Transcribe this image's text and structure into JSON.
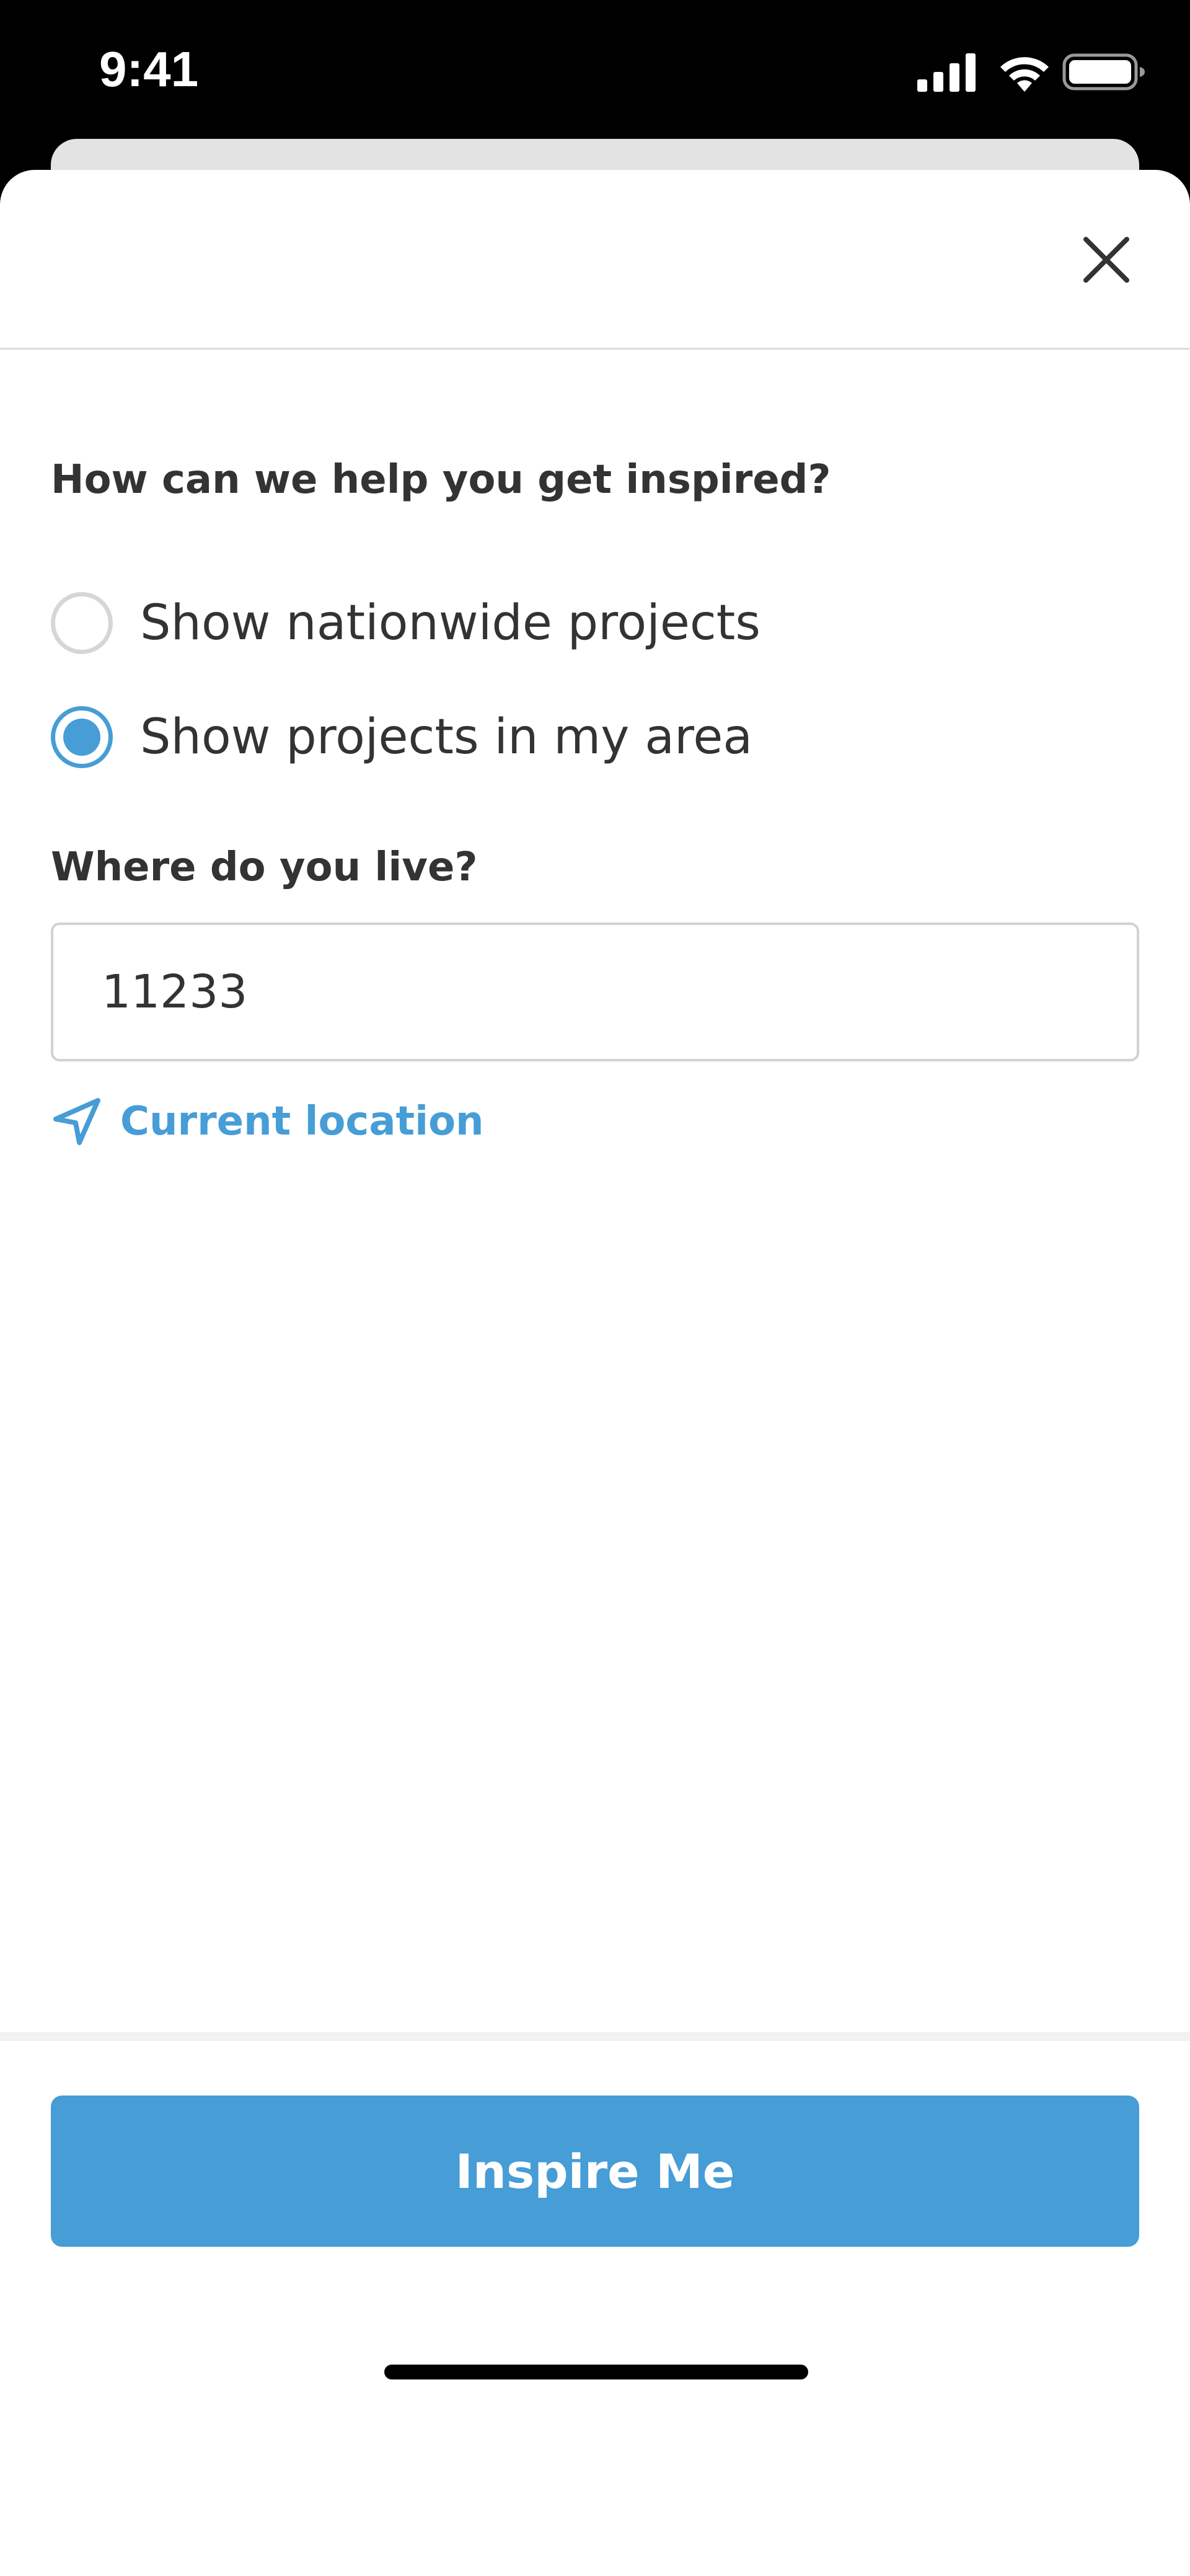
{
  "status_bar": {
    "time": "9:41",
    "icons": [
      "cellular-signal-icon",
      "wifi-icon",
      "battery-icon"
    ]
  },
  "modal": {
    "close_icon": "close-icon",
    "question": "How can we help you get inspired?",
    "options": [
      {
        "label": "Show nationwide projects",
        "selected": false
      },
      {
        "label": "Show projects in my area",
        "selected": true
      }
    ],
    "location": {
      "label": "Where do you live?",
      "value": "11233",
      "current_location_label": "Current location",
      "current_location_icon": "location-arrow-icon"
    },
    "submit_label": "Inspire Me"
  },
  "colors": {
    "accent": "#479dd6",
    "text": "#333333",
    "border": "#d2d2d2",
    "background": "#ffffff"
  }
}
